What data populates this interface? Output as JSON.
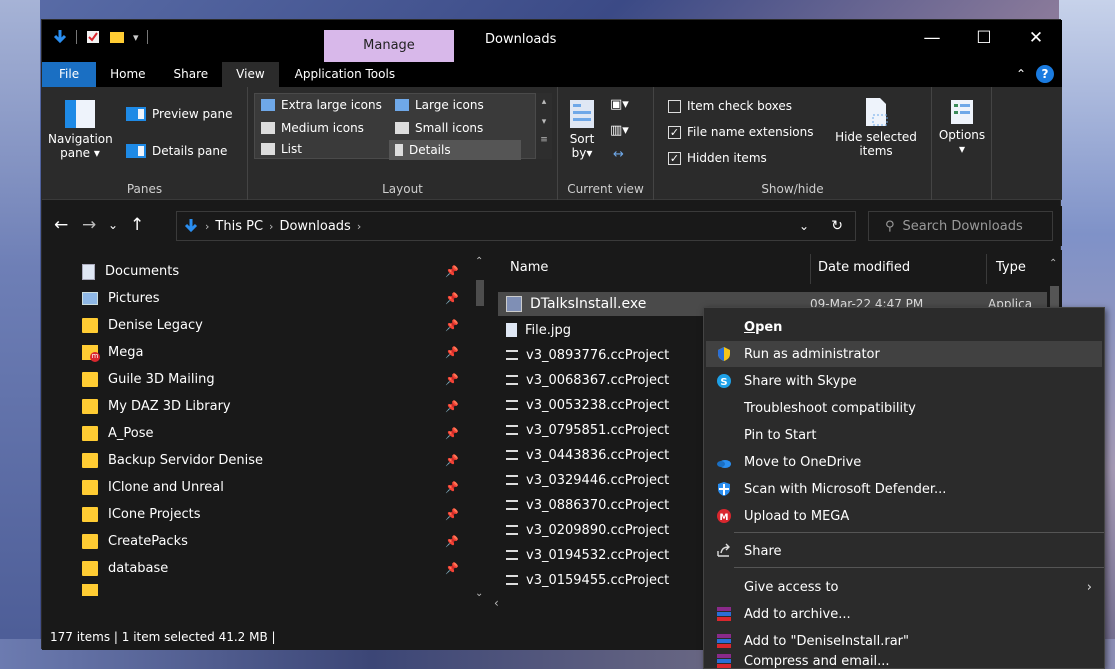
{
  "window": {
    "title": "Downloads",
    "manage_tab": "Manage",
    "controls": {
      "minimize": "—",
      "maximize": "☐",
      "close": "✕"
    }
  },
  "tabs": {
    "file": "File",
    "home": "Home",
    "share": "Share",
    "view": "View",
    "app_tools": "Application Tools"
  },
  "ribbon": {
    "panes": {
      "label": "Panes",
      "navigation_pane": "Navigation",
      "navigation_pane_2": "pane",
      "preview_pane": "Preview pane",
      "details_pane": "Details pane"
    },
    "layout": {
      "label": "Layout",
      "extra_large": "Extra large icons",
      "large": "Large icons",
      "medium": "Medium icons",
      "small": "Small icons",
      "list": "List",
      "details": "Details"
    },
    "current_view": {
      "label": "Current view",
      "sort_by": "Sort",
      "sort_by_2": "by"
    },
    "show_hide": {
      "label": "Show/hide",
      "item_check_boxes": "Item check boxes",
      "file_name_extensions": "File name extensions",
      "hidden_items": "Hidden items",
      "hide_selected": "Hide selected",
      "hide_selected_2": "items",
      "item_check_boxes_checked": false,
      "file_name_extensions_checked": true,
      "hidden_items_checked": true
    },
    "options": "Options"
  },
  "address": {
    "crumbs": [
      "This PC",
      "Downloads"
    ],
    "search_placeholder": "Search Downloads"
  },
  "nav_items": [
    {
      "label": "Documents",
      "icon": "documents-icon"
    },
    {
      "label": "Pictures",
      "icon": "pictures-icon"
    },
    {
      "label": "Denise Legacy",
      "icon": "folder-icon"
    },
    {
      "label": "Mega",
      "icon": "mega-folder-icon"
    },
    {
      "label": "Guile 3D Mailing",
      "icon": "folder-icon"
    },
    {
      "label": "My DAZ 3D Library",
      "icon": "folder-icon"
    },
    {
      "label": "A_Pose",
      "icon": "folder-icon"
    },
    {
      "label": "Backup Servidor Denise",
      "icon": "folder-icon"
    },
    {
      "label": "IClone and Unreal",
      "icon": "folder-icon"
    },
    {
      "label": "ICone Projects",
      "icon": "folder-icon"
    },
    {
      "label": "CreatePacks",
      "icon": "folder-icon"
    },
    {
      "label": "database",
      "icon": "folder-icon"
    }
  ],
  "columns": {
    "name": "Name",
    "date": "Date modified",
    "type": "Type"
  },
  "files": [
    {
      "name": "DTalksInstall.exe",
      "date": "09-Mar-22 4:47 PM",
      "type": "Applica"
    },
    {
      "name": "File.jpg",
      "date": "",
      "type": ""
    },
    {
      "name": "v3_0893776.ccProject",
      "date": "",
      "type": ""
    },
    {
      "name": "v3_0068367.ccProject",
      "date": "",
      "type": ""
    },
    {
      "name": "v3_0053238.ccProject",
      "date": "",
      "type": ""
    },
    {
      "name": "v3_0795851.ccProject",
      "date": "",
      "type": ""
    },
    {
      "name": "v3_0443836.ccProject",
      "date": "",
      "type": ""
    },
    {
      "name": "v3_0329446.ccProject",
      "date": "",
      "type": ""
    },
    {
      "name": "v3_0886370.ccProject",
      "date": "",
      "type": ""
    },
    {
      "name": "v3_0209890.ccProject",
      "date": "",
      "type": ""
    },
    {
      "name": "v3_0194532.ccProject",
      "date": "",
      "type": ""
    },
    {
      "name": "v3_0159455.ccProject",
      "date": "",
      "type": ""
    }
  ],
  "status": "177 items  |  1 item selected 41.2 MB  |",
  "context_menu": {
    "open": "Open",
    "run_as_admin": "Run as administrator",
    "share_skype": "Share with Skype",
    "troubleshoot": "Troubleshoot compatibility",
    "pin_start": "Pin to Start",
    "move_onedrive": "Move to OneDrive",
    "scan_defender": "Scan with Microsoft Defender...",
    "upload_mega": "Upload to MEGA",
    "share": "Share",
    "give_access": "Give access to",
    "add_archive": "Add to archive...",
    "add_rar": "Add to \"DeniseInstall.rar\"",
    "compress_email": "Compress and email..."
  },
  "colors": {
    "accent": "#1a6fc3",
    "manage_tab": "#d8b8ea",
    "folder": "#ffcc33",
    "window_bg": "#191919",
    "ribbon_bg": "#2b2b2b"
  }
}
